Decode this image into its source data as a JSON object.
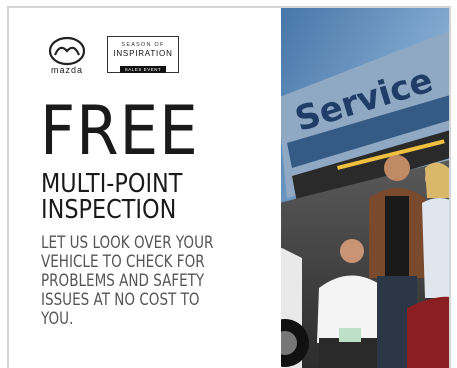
{
  "brand": {
    "wordmark": "mazda"
  },
  "event_badge": {
    "line1": "SEASON OF",
    "line2": "INSPIRATION",
    "line3": "SALES EVENT"
  },
  "offer": {
    "headline_big": "FREE",
    "headline_line1": "MULTI-POINT",
    "headline_line2": "INSPECTION",
    "body_lines": [
      "LET US LOOK OVER YOUR",
      "VEHICLE TO CHECK FOR",
      "PROBLEMS AND SAFETY",
      "ISSUES AT NO COST TO",
      "YOU."
    ]
  },
  "photo": {
    "sign_text": "Service"
  },
  "colors": {
    "text_dark": "#1a1a1a",
    "text_body": "#555555",
    "frame": "#d4d4d4",
    "sky": "#5a8fc4"
  }
}
